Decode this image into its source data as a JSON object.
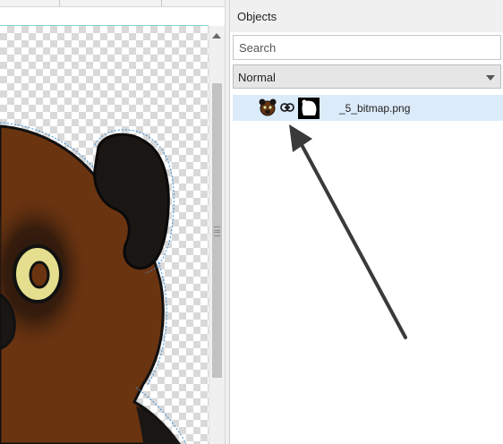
{
  "objects_panel": {
    "title": "Objects",
    "search": {
      "placeholder": "Search",
      "value": ""
    },
    "blend_mode": {
      "selected": "Normal"
    },
    "layers": [
      {
        "name": "_5_bitmap.png",
        "thumbnail_icon": "bear-thumbnail-icon",
        "link_icon": "link-icon",
        "mask_icon": "mask-thumbnail-icon",
        "selected": true
      }
    ]
  },
  "colors": {
    "accent_selection": "#dcebfa",
    "bear_fur": "#6b3410",
    "bear_dark": "#1a1614",
    "eye_ring": "#e4de8e",
    "annotation_arrow": "#3a3a3a"
  }
}
